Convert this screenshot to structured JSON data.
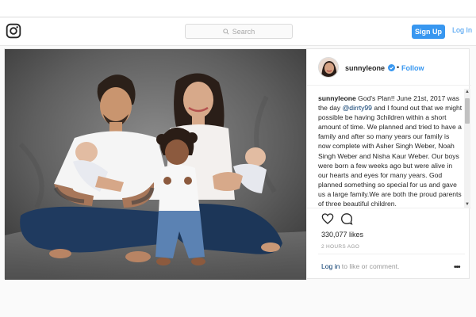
{
  "header": {
    "search_placeholder": "Search",
    "signup_label": "Sign Up",
    "login_label": "Log In"
  },
  "post": {
    "username": "sunnyleone",
    "separator": "•",
    "follow_label": "Follow",
    "caption": {
      "username": "sunnyleone",
      "text_before_mention": " God's Plan!! June 21st, 2017 was the day ",
      "mention": "@dirrty99",
      "text_after_mention": " and I found out that we might possible be having 3children within a short amount of time. We planned and tried to have a family and after so many years our family is now complete with Asher Singh Weber, Noah Singh Weber and Nisha Kaur Weber. Our boys were born a few weeks ago but were alive in our hearts and eyes for many years. God planned something so special for us and gave us a large family.We are both the proud parents of three beautiful children."
    },
    "likes": "330,077 likes",
    "time_ago": "2 HOURS AGO",
    "login_prompt_link": "Log in",
    "login_prompt_text": " to like or comment."
  },
  "colors": {
    "accent": "#3897f0",
    "link_dark": "#003569",
    "backdrop": "#6b6b6b"
  },
  "icons": {
    "logo": "instagram-logo-icon",
    "search": "search-icon",
    "verified": "verified-badge-icon",
    "like": "heart-icon",
    "comment": "comment-icon",
    "more": "more-options-icon"
  }
}
